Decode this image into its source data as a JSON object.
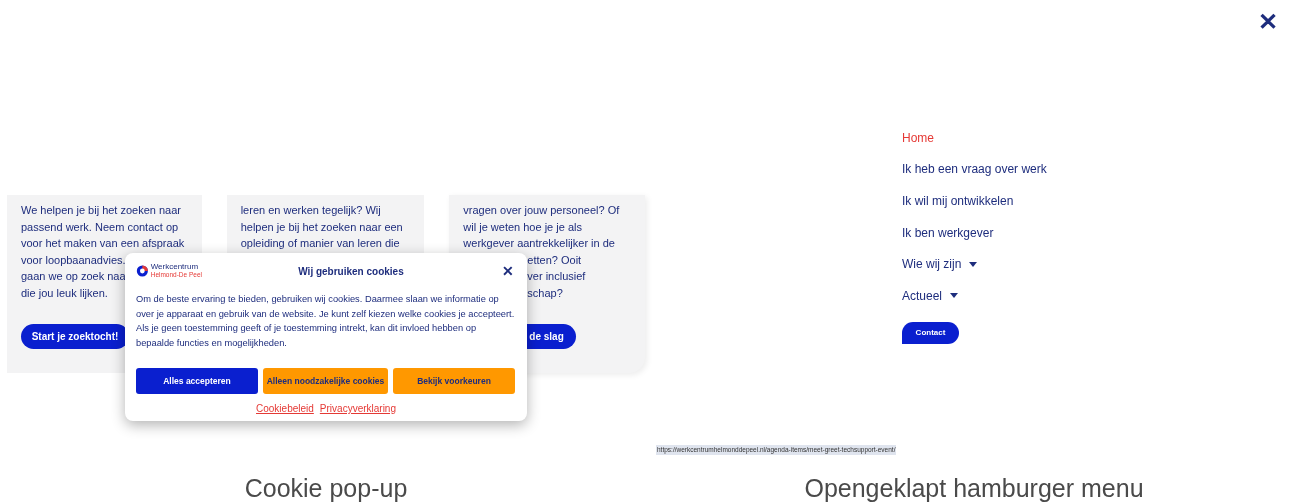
{
  "cards": [
    {
      "lines": [
        {
          "text": "We helpen je bij het zoeken naar",
          "kind": "full"
        },
        {
          "text": "passend werk. Neem contact op",
          "kind": "full"
        },
        {
          "text": "voor het maken van een afspraak",
          "kind": "full"
        },
        {
          "text": "voor loopbaanadvies.",
          "kind": "full"
        },
        {
          "text": "gaan we op zoek naa",
          "kind": "full"
        },
        {
          "text": "die jou leuk lijken.",
          "kind": "full"
        }
      ],
      "button": {
        "label": "Start je zoektocht!",
        "kind": "full"
      }
    },
    {
      "lines": [
        {
          "text": "leren en werken tegelijk? Wij",
          "kind": "full"
        },
        {
          "text": "helpen je bij het zoeken naar een",
          "kind": "full"
        },
        {
          "text": "opleiding of manier van leren die",
          "kind": "full"
        }
      ]
    },
    {
      "lines": [
        {
          "text": "vragen over jouw personeel? Of",
          "kind": "full"
        },
        {
          "text": "wil je weten hoe je je als",
          "kind": "full"
        },
        {
          "text": "werkgever aantrekkelijker in de",
          "kind": "full"
        },
        {
          "text": "etten? Ooit",
          "kind": "cut"
        },
        {
          "text": "ver inclusief",
          "kind": "cut"
        },
        {
          "text": "schap?",
          "kind": "cut"
        }
      ],
      "button": {
        "label": "de slag",
        "kind": "cut"
      }
    }
  ],
  "cookie_popup": {
    "logo_name": "Werkcentrum",
    "logo_tagline": "Helmond-De Peel",
    "title": "Wij gebruiken cookies",
    "close": "✕",
    "body": "Om de beste ervaring te bieden, gebruiken wij cookies. Daarmee slaan we informatie op over je apparaat en gebruik van de website. Je kunt zelf kiezen welke cookies je accepteert. Als je geen toestemming geeft of je toestemming intrekt, kan dit invloed hebben op bepaalde functies en mogelijkheden.",
    "buttons": [
      {
        "label": "Alles accepteren",
        "kind": "primary"
      },
      {
        "label": "Alleen noodzakelijke cookies",
        "kind": "secondary"
      },
      {
        "label": "Bekijk voorkeuren",
        "kind": "secondary"
      }
    ],
    "links": [
      "Cookiebeleid",
      "Privacyverklaring"
    ]
  },
  "left_caption": "Cookie pop-up",
  "menu": {
    "close": "✕",
    "items": [
      {
        "label": "Home",
        "selected": true,
        "dropdown": false
      },
      {
        "label": "Ik heb een vraag over werk",
        "selected": false,
        "dropdown": false
      },
      {
        "label": "Ik wil mij ontwikkelen",
        "selected": false,
        "dropdown": false
      },
      {
        "label": "Ik ben werkgever",
        "selected": false,
        "dropdown": false
      },
      {
        "label": "Wie wij zijn",
        "selected": false,
        "dropdown": true
      },
      {
        "label": "Actueel",
        "selected": false,
        "dropdown": true
      }
    ],
    "contact_button": "Contact"
  },
  "status_url": "https://werkcentrumhelmonddepeel.nl/agenda-items/meet-greet-techsupport-event/",
  "right_caption": "Opengeklapt hamburger menu"
}
